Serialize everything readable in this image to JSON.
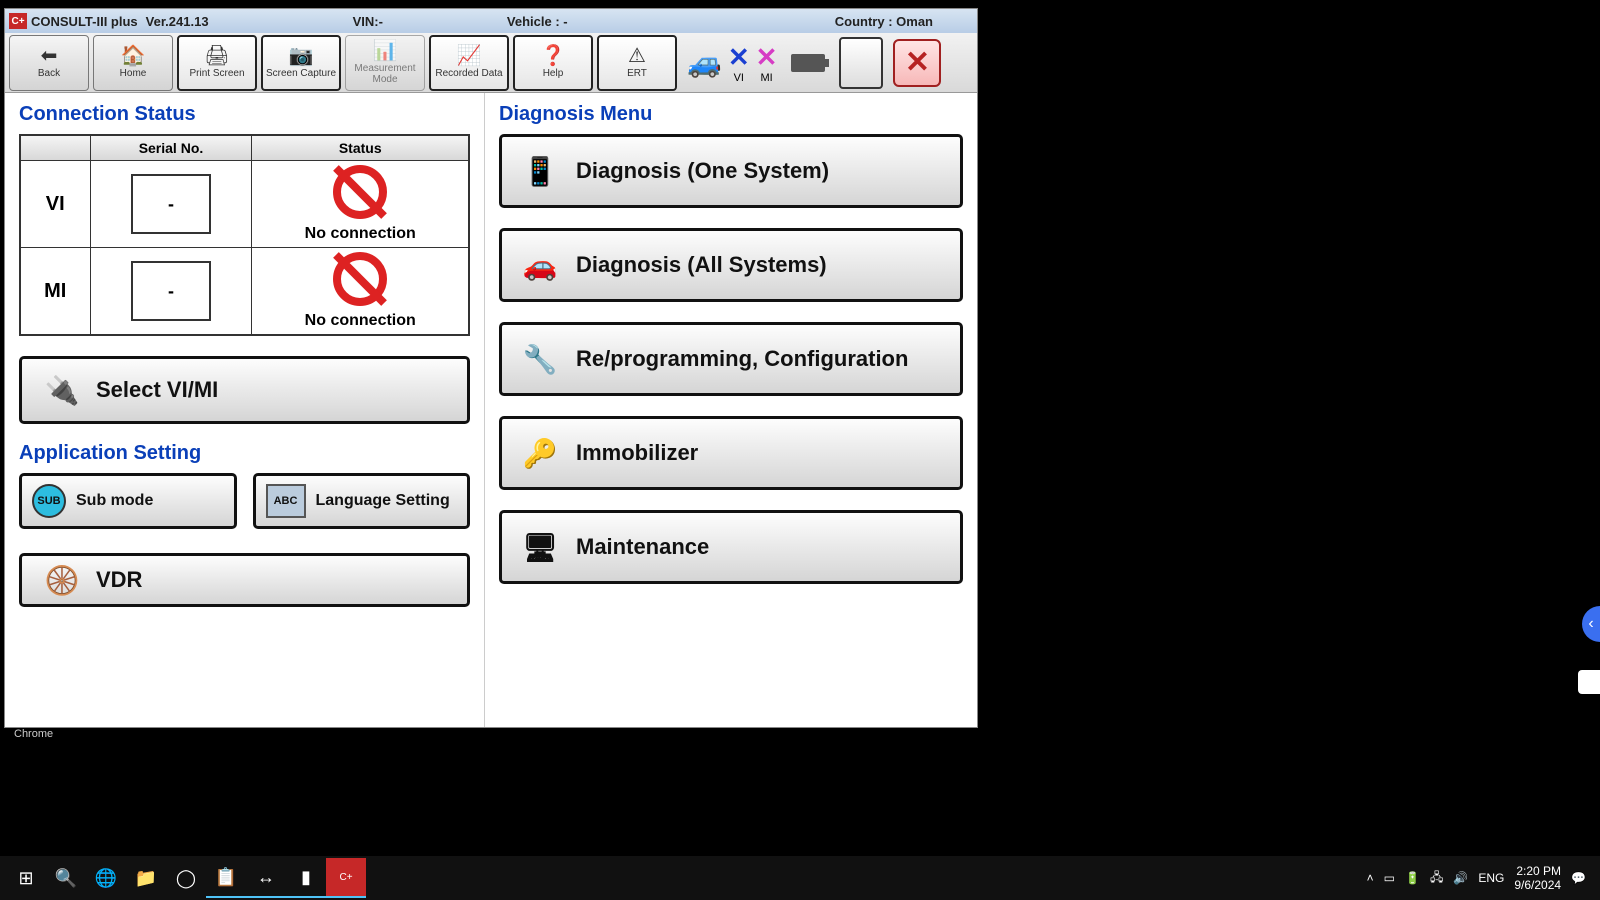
{
  "title": {
    "app": "CONSULT-III plus",
    "ver_label": "Ver.241.13",
    "vin_label": "VIN:-",
    "vehicle_label": "Vehicle : -",
    "country_label": "Country : Oman"
  },
  "toolbar": {
    "back": "Back",
    "home": "Home",
    "print": "Print Screen",
    "capture": "Screen Capture",
    "measurement": "Measurement Mode",
    "recorded": "Recorded Data",
    "help": "Help",
    "ert": "ERT",
    "vi": "VI",
    "mi": "MI"
  },
  "left": {
    "conn_title": "Connection Status",
    "cols": {
      "serial": "Serial No.",
      "status": "Status"
    },
    "rows": [
      {
        "key": "VI",
        "serial": "-",
        "status": "No connection"
      },
      {
        "key": "MI",
        "serial": "-",
        "status": "No connection"
      }
    ],
    "select_btn": "Select VI/MI",
    "app_title": "Application Setting",
    "sub_mode": "Sub mode",
    "lang_setting": "Language Setting",
    "vdr": "VDR"
  },
  "right": {
    "title": "Diagnosis Menu",
    "items": [
      "Diagnosis (One System)",
      "Diagnosis (All Systems)",
      "Re/programming, Configuration",
      "Immobilizer",
      "Maintenance"
    ]
  },
  "desktop": {
    "chrome": "Chrome"
  },
  "taskbar": {
    "lang": "ENG",
    "time": "2:20 PM",
    "date": "9/6/2024"
  }
}
